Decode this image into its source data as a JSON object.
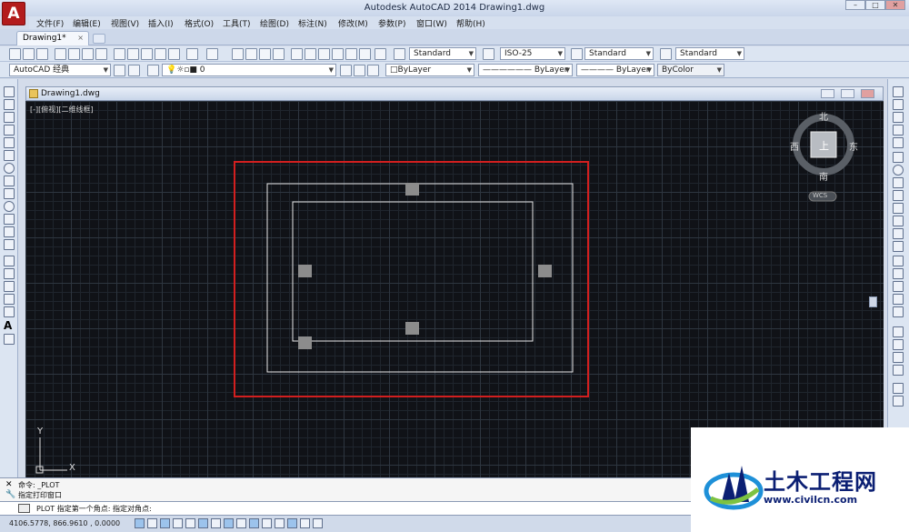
{
  "window": {
    "title": "Autodesk AutoCAD 2014     Drawing1.dwg",
    "logo": "A",
    "minimize_icon": "minimize-icon",
    "maximize_icon": "maximize-icon",
    "close_icon": "close-icon"
  },
  "menu": {
    "items": [
      "文件(F)",
      "编辑(E)",
      "视图(V)",
      "插入(I)",
      "格式(O)",
      "工具(T)",
      "绘图(D)",
      "标注(N)",
      "修改(M)",
      "参数(P)",
      "窗口(W)",
      "帮助(H)"
    ]
  },
  "tabs": {
    "doc_tab": "Drawing1*",
    "close_glyph": "×"
  },
  "toolbar": {
    "text_style": "Standard",
    "dim_style": "ISO-25",
    "table_style": "Standard",
    "multileader_style": "Standard",
    "workspace": "AutoCAD 经典",
    "layer": "0",
    "color": "ByLayer",
    "linetype": "ByLayer",
    "lineweight": "ByLayer",
    "plot_style": "ByColor"
  },
  "drawing": {
    "window_title": "Drawing1.dwg",
    "viewport_label": "[-][俯视][二维线框]",
    "viewcube": {
      "north": "北",
      "south": "南",
      "east": "东",
      "west": "西",
      "top": "上",
      "wcs": "WCS"
    },
    "ucs": {
      "x_label": "X",
      "y_label": "Y"
    },
    "colors": {
      "selection_window": "#d21f1f",
      "geometry": "#ffffff",
      "grip": "#8c8c8c",
      "background": "#101217"
    }
  },
  "command": {
    "history": [
      "命令: _PLOT",
      "指定打印窗口"
    ],
    "prompt_icon": "printer-icon",
    "prompt": "PLOT 指定第一个角点: 指定对角点:"
  },
  "status": {
    "coordinates": "4106.5778,  866.9610 ,  0.0000"
  },
  "watermark": {
    "title": "土木工程网",
    "url": "www.civilcn.com"
  }
}
